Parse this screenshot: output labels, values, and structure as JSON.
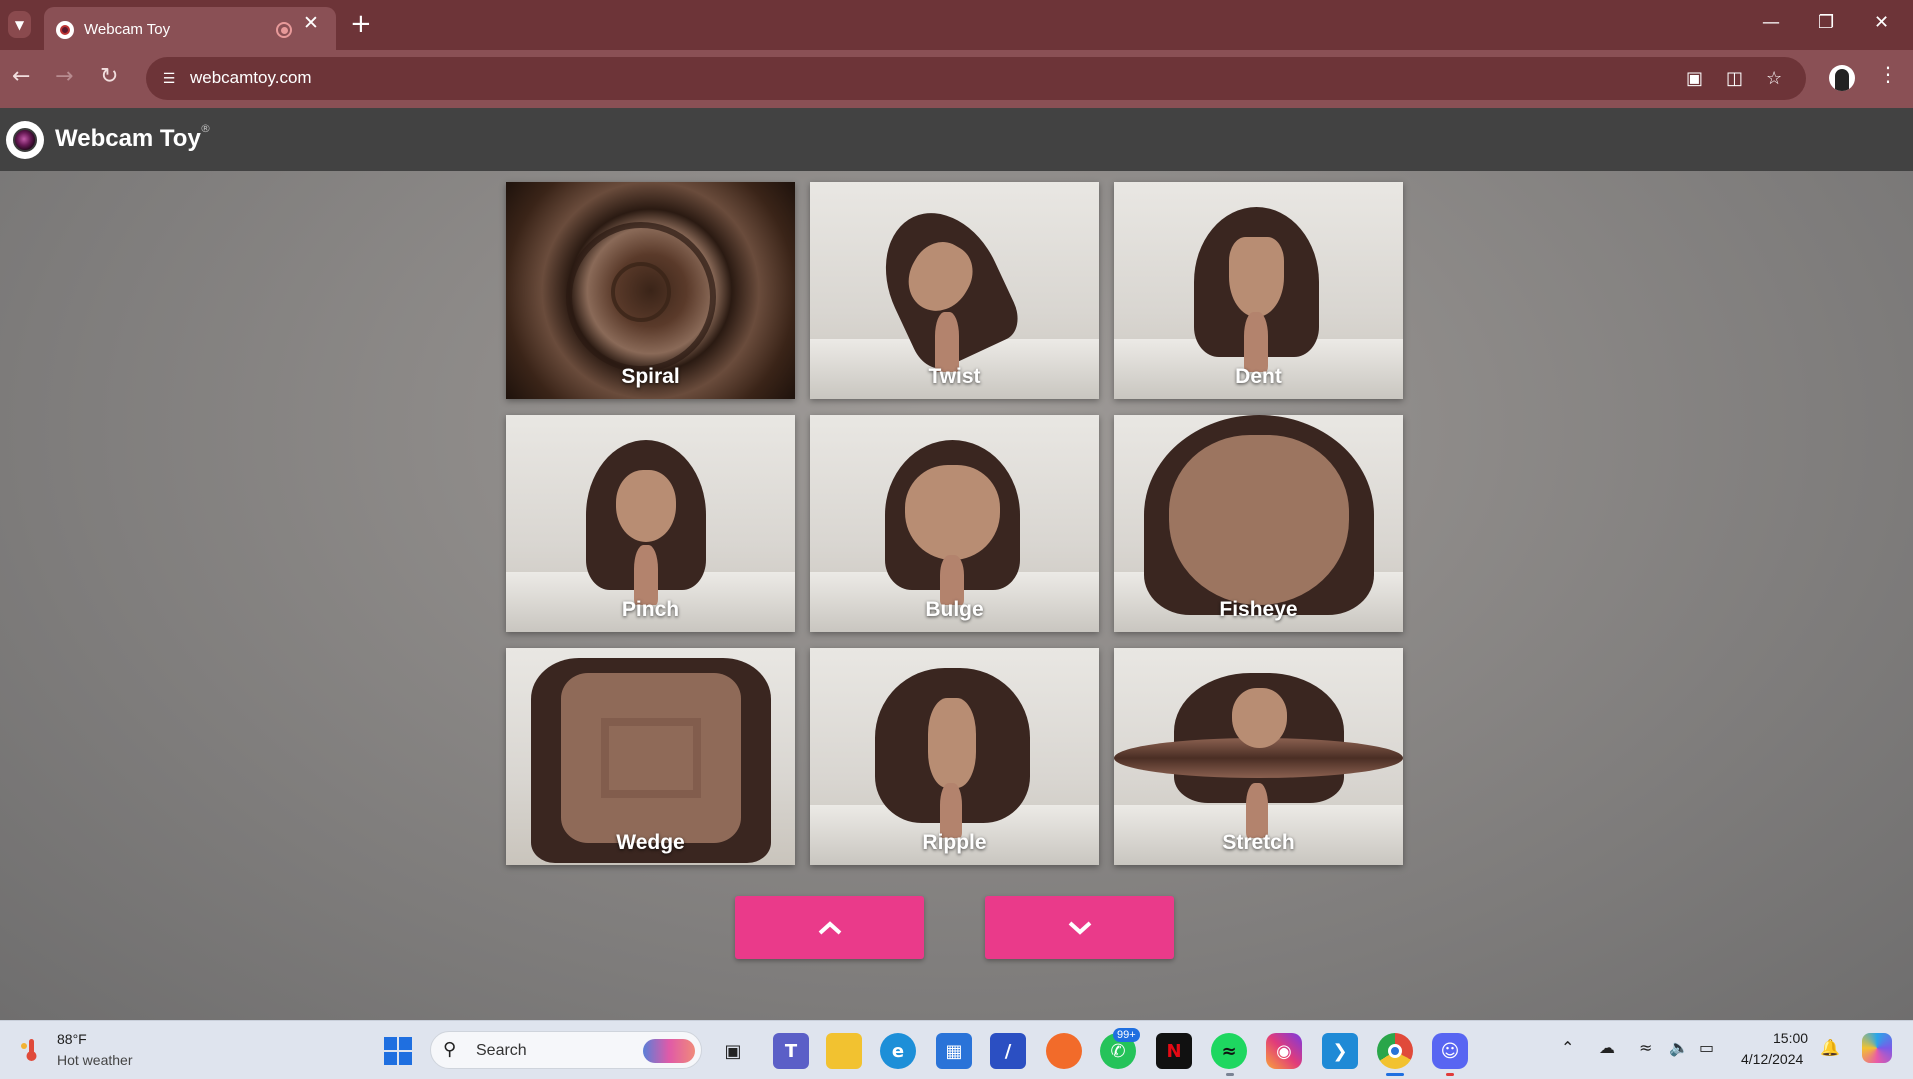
{
  "browser": {
    "tab_title": "Webcam Toy",
    "url": "webcamtoy.com",
    "new_tab_label": "+",
    "icons": [
      "tab-list-icon",
      "favicon-icon",
      "recording-icon",
      "close-icon",
      "new-tab-icon",
      "minimize-icon",
      "restore-icon",
      "window-close-icon",
      "back-icon",
      "forward-icon",
      "reload-icon",
      "site-info-icon",
      "camera-icon",
      "translate-icon",
      "bookmark-star-icon",
      "profile-icon",
      "menu-icon"
    ]
  },
  "site": {
    "title": "Webcam Toy",
    "registered_mark": "®",
    "accent_color": "#ea3a8a"
  },
  "effects": [
    {
      "label": "Spiral"
    },
    {
      "label": "Twist"
    },
    {
      "label": "Dent"
    },
    {
      "label": "Pinch"
    },
    {
      "label": "Bulge"
    },
    {
      "label": "Fisheye"
    },
    {
      "label": "Wedge"
    },
    {
      "label": "Ripple"
    },
    {
      "label": "Stretch"
    }
  ],
  "pager": {
    "up_icon": "chevron-up-icon",
    "down_icon": "chevron-down-icon"
  },
  "taskbar": {
    "weather_temp": "88°F",
    "weather_desc": "Hot weather",
    "search_placeholder": "Search",
    "whatsapp_badge": "99+",
    "time": "15:00",
    "date": "4/12/2024",
    "apps": [
      "task-view-icon",
      "teams-icon",
      "file-explorer-icon",
      "edge-icon",
      "microsoft-store-icon",
      "app-icon",
      "firefox-icon",
      "whatsapp-icon",
      "netflix-icon",
      "spotify-icon",
      "instagram-icon",
      "vscode-icon",
      "chrome-icon",
      "discord-icon"
    ],
    "tray": [
      "show-hidden-icons-icon",
      "onedrive-icon",
      "wifi-icon",
      "volume-icon",
      "battery-icon",
      "notifications-icon",
      "copilot-icon"
    ]
  }
}
